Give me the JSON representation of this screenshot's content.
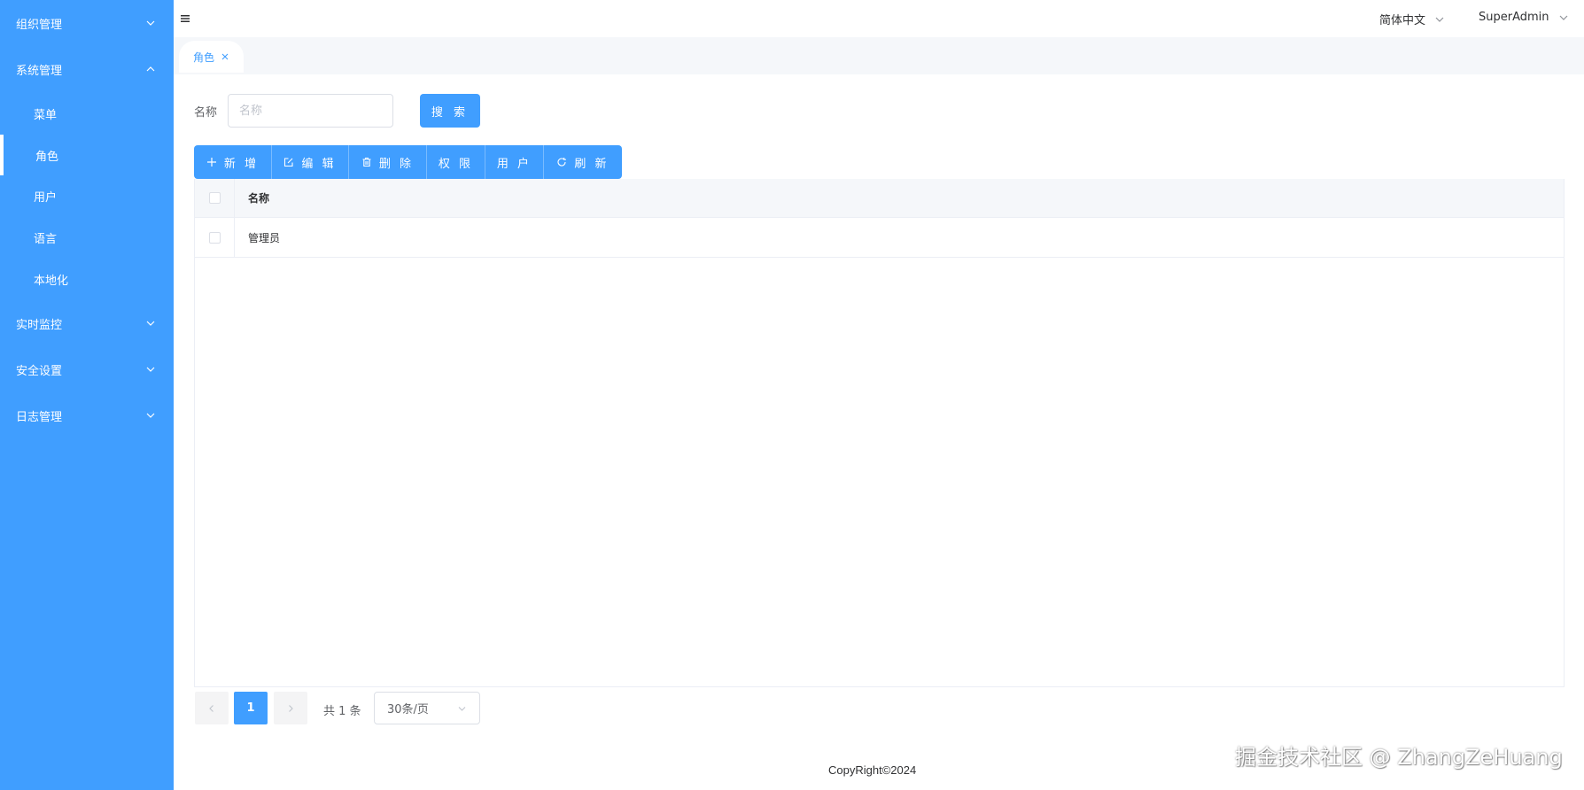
{
  "sidebar": {
    "items": [
      {
        "label": "组织管理",
        "expanded": false
      },
      {
        "label": "系统管理",
        "expanded": true
      },
      {
        "label": "菜单"
      },
      {
        "label": "角色",
        "active": true
      },
      {
        "label": "用户"
      },
      {
        "label": "语言"
      },
      {
        "label": "本地化"
      },
      {
        "label": "实时监控",
        "expanded": false
      },
      {
        "label": "安全设置",
        "expanded": false
      },
      {
        "label": "日志管理",
        "expanded": false
      }
    ]
  },
  "header": {
    "language": "简体中文",
    "user": "SuperAdmin"
  },
  "tabs": [
    {
      "label": "角色"
    }
  ],
  "search": {
    "label": "名称",
    "placeholder": "名称",
    "value": "",
    "button": "搜 索"
  },
  "toolbar": {
    "add": "新 增",
    "edit": "编 辑",
    "delete": "删 除",
    "permission": "权 限",
    "users": "用 户",
    "refresh": "刷 新"
  },
  "table": {
    "columns": [
      "名称"
    ],
    "rows": [
      {
        "name": "管理员"
      }
    ]
  },
  "pagination": {
    "current": "1",
    "total": "共 1 条",
    "page_size": "30条/页"
  },
  "footer": {
    "copyright": "CopyRight©2024",
    "watermark": "掘金技术社区 @ ZhangZeHuang"
  },
  "colors": {
    "primary": "#409eff",
    "sidebar_bg": "#409eff",
    "tab_strip_bg": "#f5f7fa",
    "border": "#ebeef5"
  }
}
